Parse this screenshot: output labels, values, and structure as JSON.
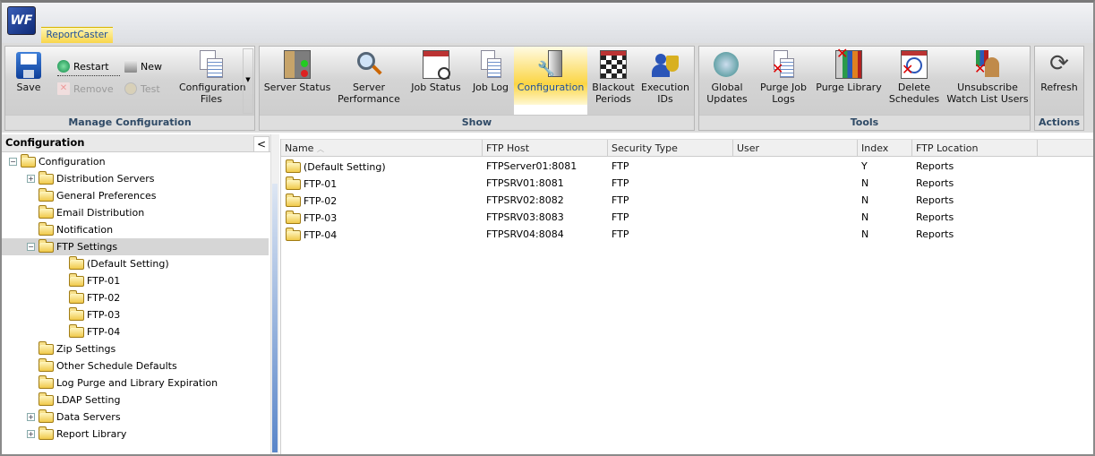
{
  "app": {
    "logo": "WF",
    "tab": "ReportCaster"
  },
  "ribbon": {
    "manage": {
      "label": "Manage Configuration",
      "save": "Save",
      "restart": "Restart",
      "remove": "Remove",
      "new": "New",
      "test": "Test",
      "config_files": [
        "Configuration",
        "Files"
      ]
    },
    "show": {
      "label": "Show",
      "buttons": [
        [
          "Server Status",
          ""
        ],
        [
          "Server",
          "Performance"
        ],
        [
          "Job Status",
          ""
        ],
        [
          "Job Log",
          ""
        ],
        [
          "Configuration",
          ""
        ],
        [
          "Blackout",
          "Periods"
        ],
        [
          "Execution",
          "IDs"
        ]
      ]
    },
    "tools": {
      "label": "Tools",
      "buttons": [
        [
          "Global",
          "Updates"
        ],
        [
          "Purge Job",
          "Logs"
        ],
        [
          "Purge Library",
          ""
        ],
        [
          "Delete",
          "Schedules"
        ],
        [
          "Unsubscribe",
          "Watch List Users"
        ]
      ]
    },
    "actions": {
      "label": "Actions",
      "refresh": "Refresh"
    }
  },
  "tree": {
    "title": "Configuration",
    "collapse": "<",
    "items": [
      {
        "label": "Configuration",
        "level": 0,
        "exp": "−"
      },
      {
        "label": "Distribution Servers",
        "level": 1,
        "exp": "+"
      },
      {
        "label": "General Preferences",
        "level": 1
      },
      {
        "label": "Email Distribution",
        "level": 1
      },
      {
        "label": "Notification",
        "level": 1
      },
      {
        "label": "FTP Settings",
        "level": 1,
        "exp": "−",
        "selected": true
      },
      {
        "label": "(Default Setting)",
        "level": 2
      },
      {
        "label": "FTP-01",
        "level": 2
      },
      {
        "label": "FTP-02",
        "level": 2
      },
      {
        "label": "FTP-03",
        "level": 2
      },
      {
        "label": "FTP-04",
        "level": 2
      },
      {
        "label": "Zip Settings",
        "level": 1
      },
      {
        "label": "Other Schedule Defaults",
        "level": 1
      },
      {
        "label": "Log Purge and Library Expiration",
        "level": 1
      },
      {
        "label": "LDAP Setting",
        "level": 1
      },
      {
        "label": "Data Servers",
        "level": 1,
        "exp": "+"
      },
      {
        "label": "Report Library",
        "level": 1,
        "exp": "+"
      }
    ]
  },
  "grid": {
    "columns": [
      "Name",
      "FTP Host",
      "Security Type",
      "User",
      "Index",
      "FTP Location"
    ],
    "rows": [
      [
        "(Default Setting)",
        "FTPServer01:8081",
        "FTP",
        "",
        "Y",
        "Reports"
      ],
      [
        "FTP-01",
        "FTPSRV01:8081",
        "FTP",
        "",
        "N",
        "Reports"
      ],
      [
        "FTP-02",
        "FTPSRV02:8082",
        "FTP",
        "",
        "N",
        "Reports"
      ],
      [
        "FTP-03",
        "FTPSRV03:8083",
        "FTP",
        "",
        "N",
        "Reports"
      ],
      [
        "FTP-04",
        "FTPSRV04:8084",
        "FTP",
        "",
        "N",
        "Reports"
      ]
    ]
  }
}
